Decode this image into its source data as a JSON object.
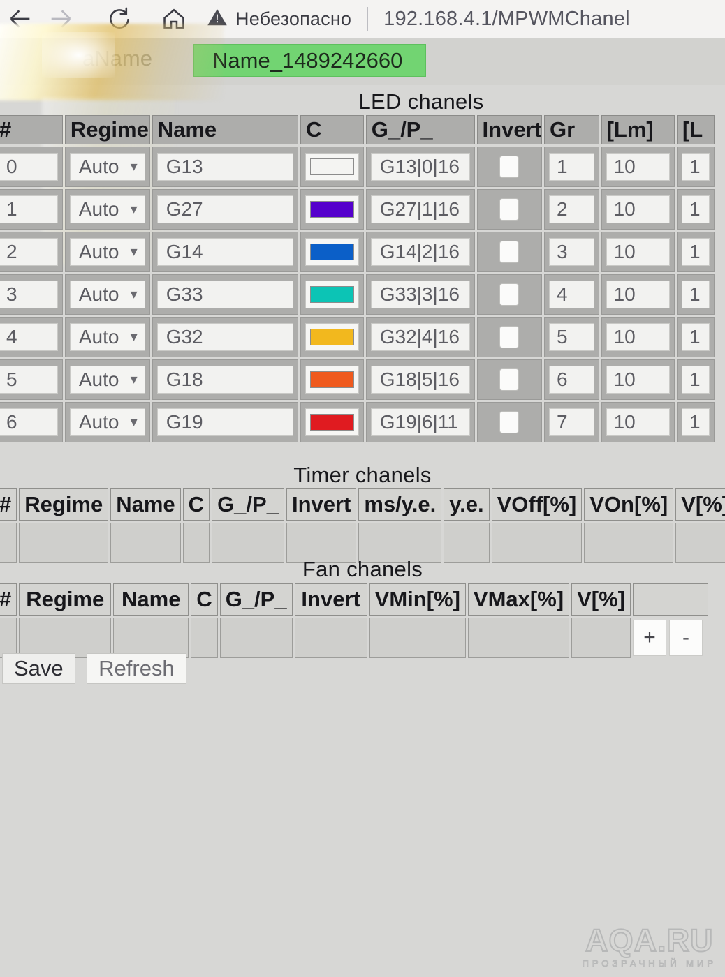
{
  "browser": {
    "back_icon": "arrow-left-icon",
    "forward_icon": "arrow-right-icon",
    "reload_icon": "reload-icon",
    "home_icon": "home-icon",
    "warning_icon": "warning-triangle-icon",
    "security_text": "Небезопасно",
    "url": "192.168.4.1/MPWMChanel"
  },
  "name_strip": {
    "label": "aName",
    "value": "Name_1489242660",
    "bg_color": "#72d472"
  },
  "led": {
    "title": "LED chanels",
    "headers": [
      "#",
      "Regime",
      "Name",
      "C",
      "G_/P_",
      "Invert",
      "Gr",
      "[Lm]",
      "[L"
    ],
    "rows": [
      {
        "num": "0",
        "regime": "Auto",
        "name": "G13",
        "color": "#f4f4f2",
        "gp": "G13|0|16",
        "invert": false,
        "gr": "1",
        "lm": "10",
        "last": "1"
      },
      {
        "num": "1",
        "regime": "Auto",
        "name": "G27",
        "color": "#5500cc",
        "gp": "G27|1|16",
        "invert": false,
        "gr": "2",
        "lm": "10",
        "last": "1"
      },
      {
        "num": "2",
        "regime": "Auto",
        "name": "G14",
        "color": "#0b5fc8",
        "gp": "G14|2|16",
        "invert": false,
        "gr": "3",
        "lm": "10",
        "last": "1"
      },
      {
        "num": "3",
        "regime": "Auto",
        "name": "G33",
        "color": "#0cc4b5",
        "gp": "G33|3|16",
        "invert": false,
        "gr": "4",
        "lm": "10",
        "last": "1"
      },
      {
        "num": "4",
        "regime": "Auto",
        "name": "G32",
        "color": "#f2b81e",
        "gp": "G32|4|16",
        "invert": false,
        "gr": "5",
        "lm": "10",
        "last": "1"
      },
      {
        "num": "5",
        "regime": "Auto",
        "name": "G18",
        "color": "#ef5a1e",
        "gp": "G18|5|16",
        "invert": false,
        "gr": "6",
        "lm": "10",
        "last": "1"
      },
      {
        "num": "6",
        "regime": "Auto",
        "name": "G19",
        "color": "#e01b20",
        "gp": "G19|6|11",
        "invert": false,
        "gr": "7",
        "lm": "10",
        "last": "1"
      }
    ]
  },
  "timer": {
    "title": "Timer chanels",
    "headers": [
      "#",
      "Regime",
      "Name",
      "C",
      "G_/P_",
      "Invert",
      "ms/y.e.",
      "y.e.",
      "VOff[%]",
      "VOn[%]",
      "V[%]",
      ""
    ],
    "rows": [],
    "add_label": "+",
    "remove_label": "-"
  },
  "fan": {
    "title": "Fan chanels",
    "headers": [
      "#",
      "Regime",
      "Name",
      "C",
      "G_/P_",
      "Invert",
      "VMin[%]",
      "VMax[%]",
      "V[%]",
      ""
    ],
    "rows": [],
    "add_label": "+",
    "remove_label": "-"
  },
  "actions": {
    "save_label": "Save",
    "refresh_label": "Refresh"
  },
  "watermark": {
    "main": "AQA.RU",
    "sub": "ПРОЗРАЧНЫЙ МИР"
  }
}
